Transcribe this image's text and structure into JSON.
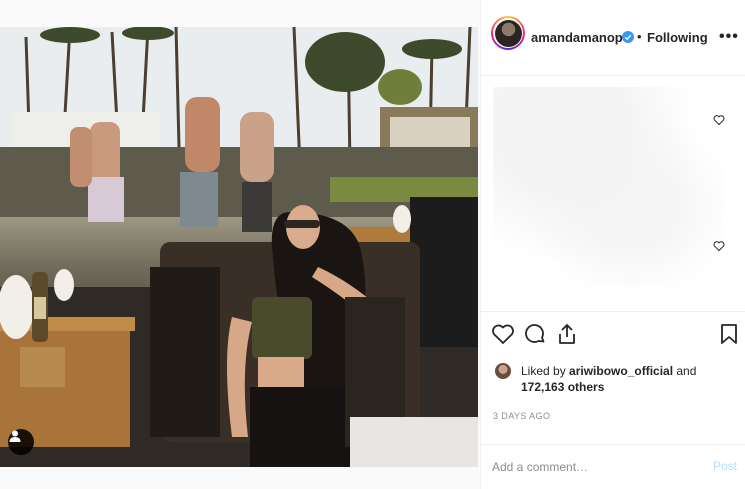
{
  "header": {
    "username": "amandamanopo",
    "separator": "•",
    "follow_status": "Following",
    "more_label": "•••"
  },
  "actions": {
    "liked_by_prefix": "Liked by ",
    "liked_by_user": "ariwibowo_official",
    "liked_by_suffix": " and",
    "others_count": "172,163 others",
    "timestamp": "3 DAYS AGO"
  },
  "comment_box": {
    "placeholder": "Add a comment…",
    "post_label": "Post"
  },
  "icons": {
    "verified": "verified-badge-icon",
    "like": "heart-icon",
    "comment": "comment-icon",
    "share": "share-icon",
    "save": "bookmark-icon",
    "tag": "user-tag-icon",
    "more": "more-options-icon"
  },
  "colors": {
    "verified_blue": "#3897f0",
    "post_disabled": "#b2dffc",
    "muted_text": "#8e8e8e"
  }
}
